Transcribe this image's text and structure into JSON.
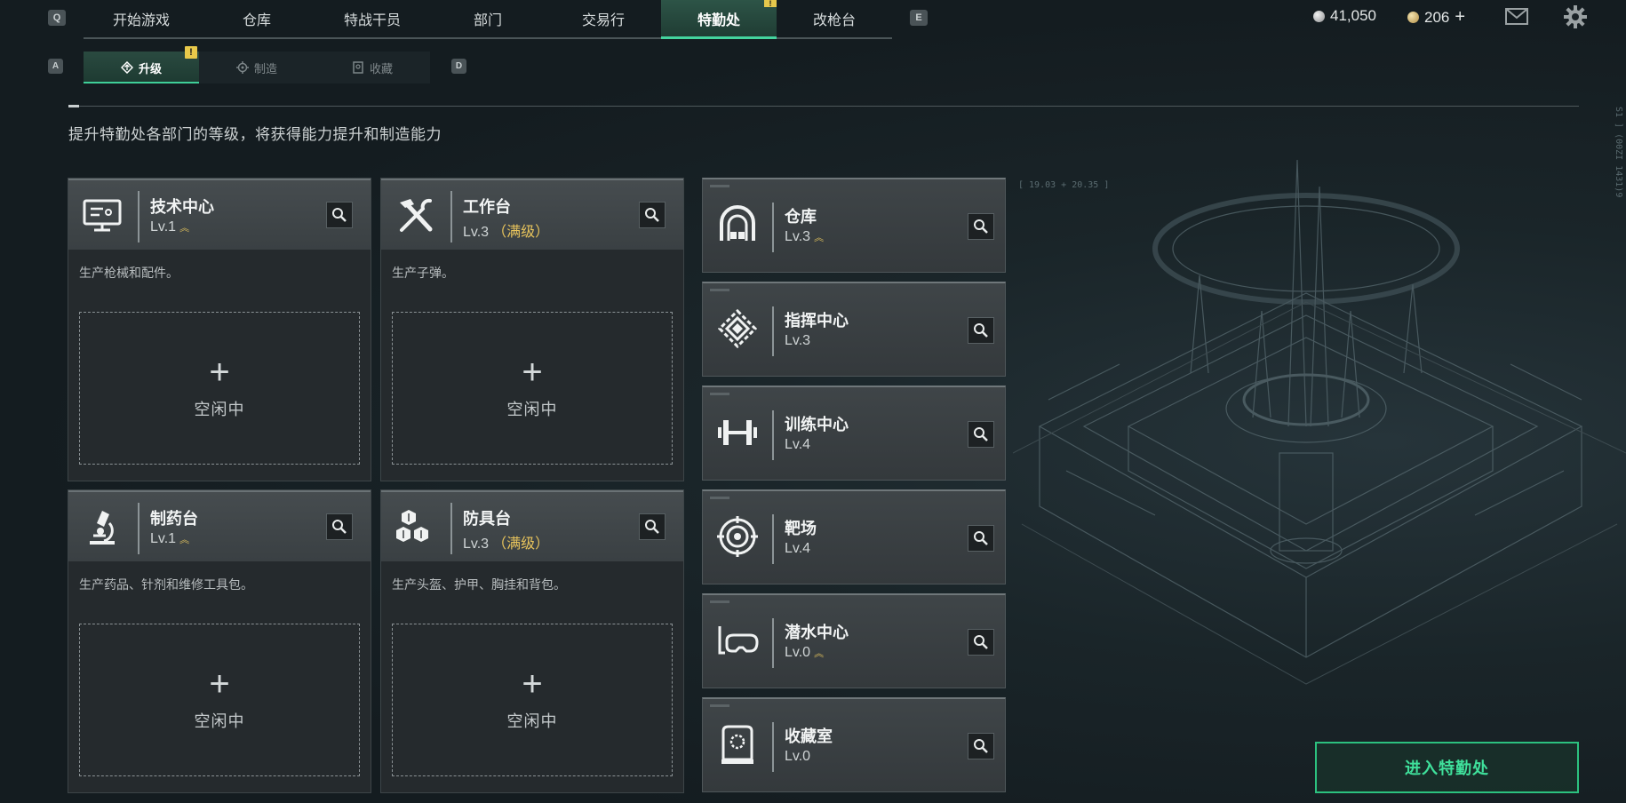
{
  "top_nav": {
    "left_key": "Q",
    "right_key": "E",
    "tabs": [
      {
        "label": "开始游戏",
        "active": false
      },
      {
        "label": "仓库",
        "active": false
      },
      {
        "label": "特战干员",
        "active": false
      },
      {
        "label": "部门",
        "active": false
      },
      {
        "label": "交易行",
        "active": false
      },
      {
        "label": "特勤处",
        "active": true,
        "alert": "!"
      },
      {
        "label": "改枪台",
        "active": false
      }
    ]
  },
  "currency": {
    "silver": "41,050",
    "gold": "206",
    "add_symbol": "+"
  },
  "icons": {
    "mail": "mail-icon",
    "settings": "gear-icon"
  },
  "sub_nav": {
    "left_key": "A",
    "right_key": "D",
    "tabs": [
      {
        "label": "升级",
        "icon": "upgrade-icon",
        "active": true,
        "badge": "!"
      },
      {
        "label": "制造",
        "icon": "gear-icon",
        "active": false
      },
      {
        "label": "收藏",
        "icon": "collection-icon",
        "active": false
      }
    ]
  },
  "subtitle": "提升特勤处各部门的等级，将获得能力提升和制造能力",
  "workstations": [
    {
      "title": "技术中心",
      "level": "Lv.1",
      "maxed": "",
      "upgradable": true,
      "icon": "computer-icon",
      "description": "生产枪械和配件。",
      "slot_plus": "+",
      "slot_label": "空闲中"
    },
    {
      "title": "工作台",
      "level": "Lv.3",
      "maxed": "（满级）",
      "upgradable": false,
      "icon": "tools-icon",
      "description": "生产子弹。",
      "slot_plus": "+",
      "slot_label": "空闲中"
    },
    {
      "title": "制药台",
      "level": "Lv.1",
      "maxed": "",
      "upgradable": true,
      "icon": "microscope-icon",
      "description": "生产药品、针剂和维修工具包。",
      "slot_plus": "+",
      "slot_label": "空闲中"
    },
    {
      "title": "防具台",
      "level": "Lv.3",
      "maxed": "（满级）",
      "upgradable": false,
      "icon": "armor-boxes-icon",
      "description": "生产头盔、护甲、胸挂和背包。",
      "slot_plus": "+",
      "slot_label": "空闲中"
    }
  ],
  "facilities": [
    {
      "title": "仓库",
      "level": "Lv.3",
      "upgradable": true,
      "icon": "warehouse-icon"
    },
    {
      "title": "指挥中心",
      "level": "Lv.3",
      "upgradable": false,
      "icon": "command-center-icon"
    },
    {
      "title": "训练中心",
      "level": "Lv.4",
      "upgradable": false,
      "icon": "dumbbell-icon"
    },
    {
      "title": "靶场",
      "level": "Lv.4",
      "upgradable": false,
      "icon": "target-icon"
    },
    {
      "title": "潜水中心",
      "level": "Lv.0",
      "upgradable": true,
      "icon": "diving-mask-icon"
    },
    {
      "title": "收藏室",
      "level": "Lv.0",
      "upgradable": false,
      "icon": "display-case-icon"
    }
  ],
  "hud": {
    "coords": "[ 19.03 + 20.35 ]",
    "side_code": "S1 ] (00ZI 1431)9"
  },
  "enter_button": "进入特勤处"
}
